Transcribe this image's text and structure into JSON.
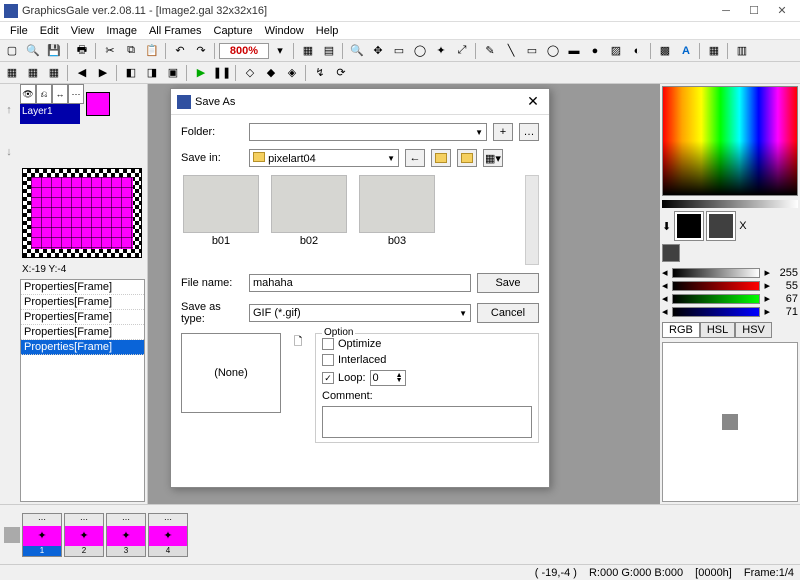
{
  "title": "GraphicsGale ver.2.08.11 - [Image2.gal 32x32x16]",
  "menu": [
    "File",
    "Edit",
    "View",
    "Image",
    "All Frames",
    "Capture",
    "Window",
    "Help"
  ],
  "zoom": "800%",
  "layer": {
    "name": "Layer1"
  },
  "coord": "X:-19 Y:-4",
  "properties": [
    "Properties[Frame]",
    "Properties[Frame]",
    "Properties[Frame]",
    "Properties[Frame]",
    "Properties[Frame]"
  ],
  "frames": [
    "1",
    "2",
    "3",
    "4"
  ],
  "colors": {
    "fg": "#000000",
    "bg": "#404040",
    "sliders": [
      {
        "class": "gray",
        "val": "255"
      },
      {
        "class": "red",
        "val": "55"
      },
      {
        "class": "green",
        "val": "67"
      },
      {
        "class": "blue",
        "val": "71"
      }
    ],
    "tabs": [
      "RGB",
      "HSL",
      "HSV"
    ]
  },
  "status": {
    "pos": "( -19,-4 )",
    "rgb": "R:000 G:000 B:000",
    "hex": "[0000h]",
    "frame": "Frame:1/4"
  },
  "dialog": {
    "title": "Save As",
    "folder_label": "Folder:",
    "savein_label": "Save in:",
    "savein_value": "pixelart04",
    "files": [
      "b01",
      "b02",
      "b03"
    ],
    "filename_label": "File name:",
    "filename_value": "mahaha",
    "type_label": "Save as type:",
    "type_value": "GIF (*.gif)",
    "save_btn": "Save",
    "cancel_btn": "Cancel",
    "preview_none": "(None)",
    "option_legend": "Option",
    "opt_optimize": "Optimize",
    "opt_interlaced": "Interlaced",
    "opt_loop": "Loop:",
    "loop_value": "0",
    "comment_label": "Comment:"
  }
}
